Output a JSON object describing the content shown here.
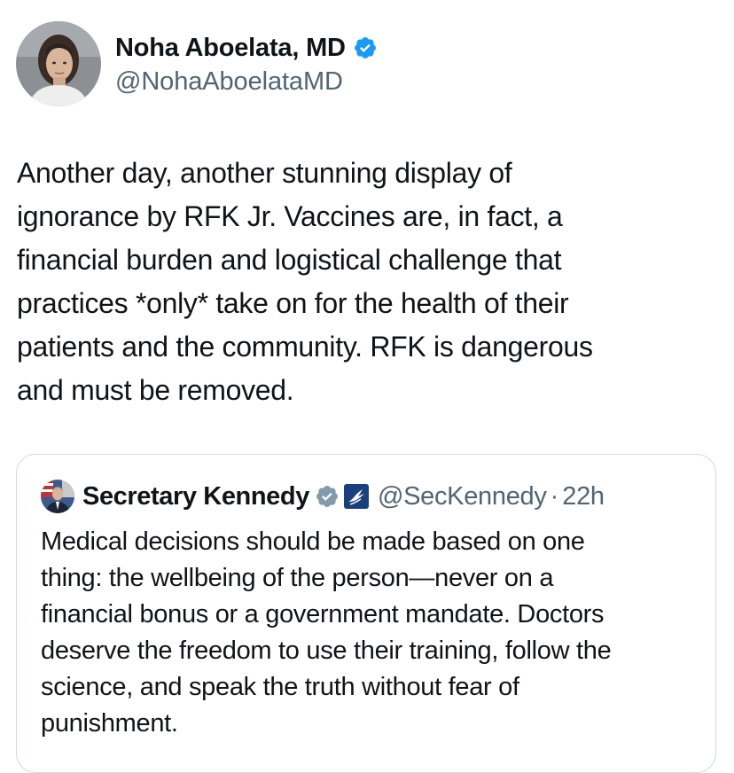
{
  "author": {
    "display_name": "Noha Aboelata, MD",
    "handle": "@NohaAboelataMD",
    "verified": true,
    "verified_color": "#1d9bf0"
  },
  "tweet": {
    "text": "Another day, another stunning display of\nignorance by RFK Jr. Vaccines are, in fact, a\nfinancial burden and logistical challenge that\npractices *only* take on for the health of their\npatients and the community. RFK is dangerous\nand must be removed."
  },
  "quoted_tweet": {
    "display_name": "Secretary Kennedy",
    "verified_badge": "gray-check",
    "verified_color": "#829aab",
    "org_badge": "hhs-eagle-icon",
    "org_badge_color": "#1b3f7a",
    "handle": "@SecKennedy",
    "separator": "·",
    "time": "22h",
    "text": "Medical decisions should be made based on one\nthing: the wellbeing of the person—never on a\nfinancial bonus or a government mandate. Doctors\ndeserve the freedom to use their training, follow the\nscience, and speak the truth without fear of\npunishment."
  },
  "colors": {
    "text": "#0f1419",
    "secondary_text": "#536471",
    "border": "#cfd9de"
  }
}
